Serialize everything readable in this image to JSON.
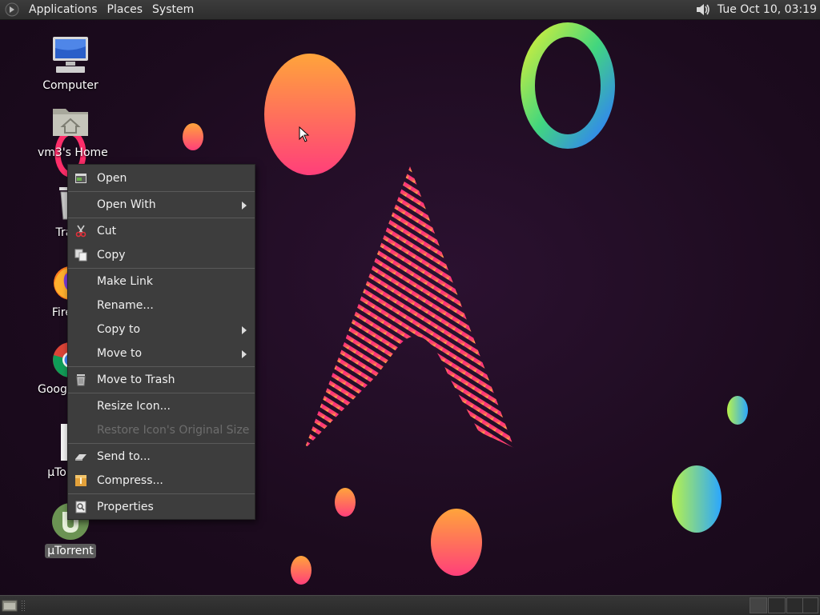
{
  "top_panel": {
    "menus": [
      "Applications",
      "Places",
      "System"
    ],
    "clock": "Tue Oct 10, 03:19",
    "icons": {
      "menu": "gnome-foot-icon",
      "volume": "speaker-icon"
    }
  },
  "desktop": {
    "icons": [
      {
        "label": "Computer",
        "icon": "computer-icon",
        "selected": false
      },
      {
        "label": "vm3's Home",
        "icon": "home-folder-icon",
        "selected": false
      },
      {
        "label": "Trash",
        "icon": "trash-icon",
        "selected": false
      },
      {
        "label": "Firefox",
        "icon": "firefox-icon",
        "selected": false
      },
      {
        "label": "Google Chrome",
        "icon": "chrome-icon",
        "selected": false
      },
      {
        "label": "µTorrent",
        "icon": "file-icon",
        "selected": false
      },
      {
        "label": "µTorrent",
        "icon": "utorrent-icon",
        "selected": true
      }
    ]
  },
  "context_menu": {
    "items": [
      {
        "label": "Open",
        "icon": "open-icon",
        "submenu": false,
        "enabled": true
      },
      {
        "label": "Open With",
        "icon": "",
        "submenu": true,
        "enabled": true
      },
      {
        "label": "Cut",
        "icon": "scissors-icon",
        "submenu": false,
        "enabled": true
      },
      {
        "label": "Copy",
        "icon": "copy-icon",
        "submenu": false,
        "enabled": true
      },
      {
        "label": "Make Link",
        "icon": "",
        "submenu": false,
        "enabled": true
      },
      {
        "label": "Rename...",
        "icon": "",
        "submenu": false,
        "enabled": true
      },
      {
        "label": "Copy to",
        "icon": "",
        "submenu": true,
        "enabled": true
      },
      {
        "label": "Move to",
        "icon": "",
        "submenu": true,
        "enabled": true
      },
      {
        "label": "Move to Trash",
        "icon": "trash-icon",
        "submenu": false,
        "enabled": true
      },
      {
        "label": "Resize Icon...",
        "icon": "",
        "submenu": false,
        "enabled": true
      },
      {
        "label": "Restore Icon's Original Size",
        "icon": "",
        "submenu": false,
        "enabled": false
      },
      {
        "label": "Send to...",
        "icon": "send-icon",
        "submenu": false,
        "enabled": true
      },
      {
        "label": "Compress...",
        "icon": "archive-icon",
        "submenu": false,
        "enabled": true
      },
      {
        "label": "Properties",
        "icon": "properties-icon",
        "submenu": false,
        "enabled": true
      }
    ]
  },
  "colors": {
    "panel": "#2e2e2e",
    "menu_bg": "#3d3d3d",
    "wallpaper_bg": "#1c0b1e",
    "accent_pink": "#ff2e7e",
    "accent_orange": "#ffa23a"
  }
}
